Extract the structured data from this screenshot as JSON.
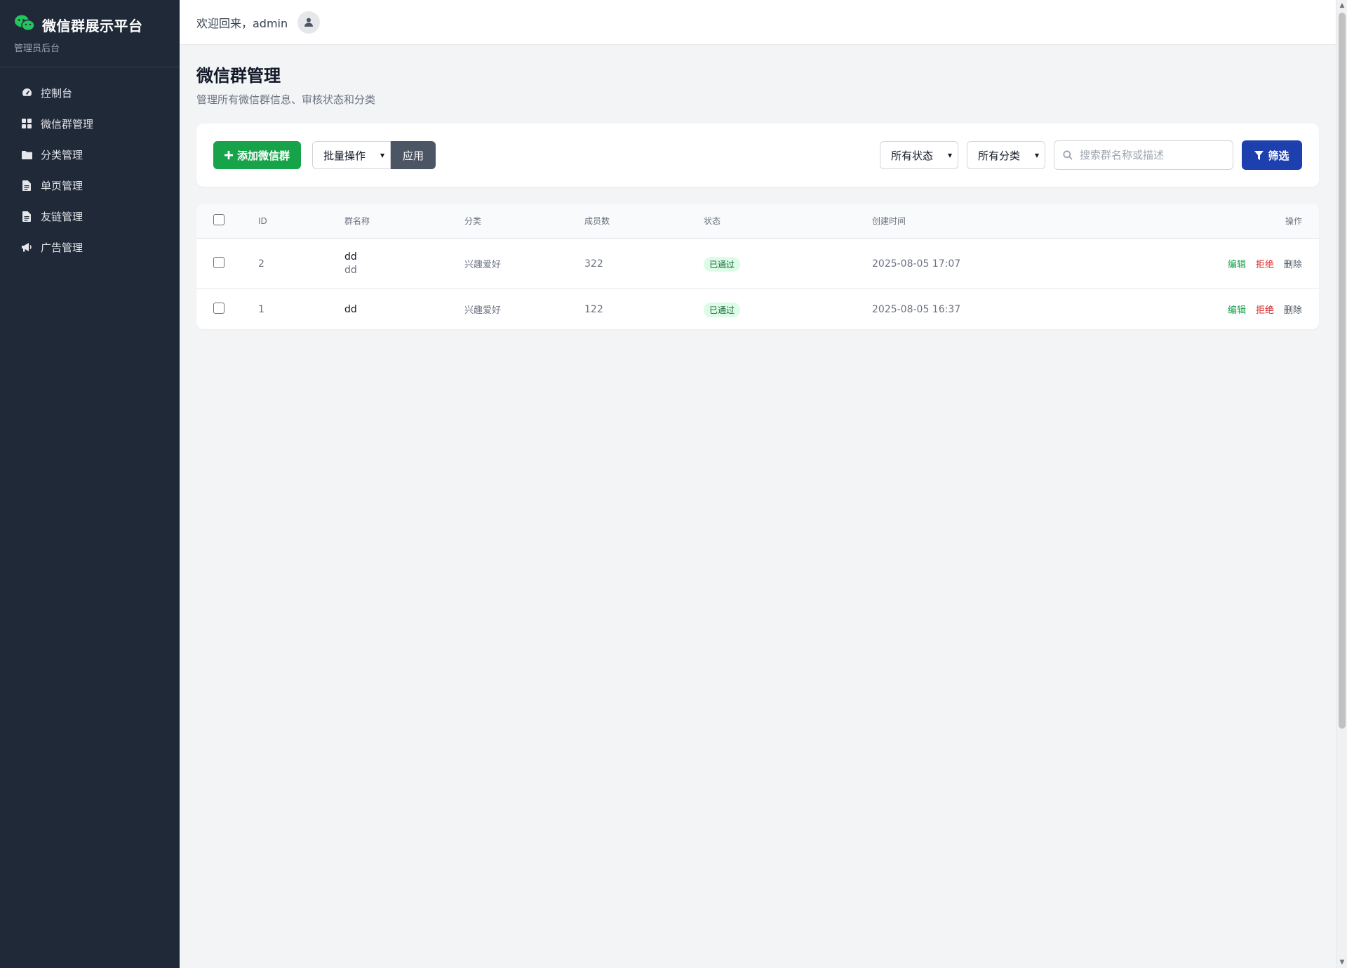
{
  "colors": {
    "sidebar_bg": "#1f2937",
    "primary_green": "#16a34a",
    "filter_blue": "#1e40af",
    "apply_gray": "#4b5563",
    "reject_red": "#dc2626",
    "badge_bg": "#dcfce7",
    "page_bg": "#f3f4f6"
  },
  "brand": {
    "title": "微信群展示平台",
    "subtitle": "管理员后台",
    "icon": "wechat-icon"
  },
  "sidebar": {
    "items": [
      {
        "label": "控制台",
        "icon": "dashboard-icon"
      },
      {
        "label": "微信群管理",
        "icon": "grid-icon"
      },
      {
        "label": "分类管理",
        "icon": "folder-icon"
      },
      {
        "label": "单页管理",
        "icon": "file-icon"
      },
      {
        "label": "友链管理",
        "icon": "file-text-icon"
      },
      {
        "label": "广告管理",
        "icon": "megaphone-icon"
      }
    ]
  },
  "header": {
    "welcome": "欢迎回来，admin",
    "avatar_icon": "user-icon"
  },
  "page": {
    "title": "微信群管理",
    "subtitle": "管理所有微信群信息、审核状态和分类"
  },
  "toolbar": {
    "add_label": "添加微信群",
    "batch_selected": "批量操作",
    "apply_label": "应用",
    "status_selected": "所有状态",
    "category_selected": "所有分类",
    "search_placeholder": "搜索群名称或描述",
    "filter_label": "筛选"
  },
  "table": {
    "headers": {
      "id": "ID",
      "name": "群名称",
      "category": "分类",
      "members": "成员数",
      "status": "状态",
      "created": "创建时间",
      "actions": "操作"
    },
    "rows": [
      {
        "id": "2",
        "name": "dd",
        "desc": "dd",
        "category": "兴趣爱好",
        "members": "322",
        "status": "已通过",
        "created": "2025-08-05 17:07"
      },
      {
        "id": "1",
        "name": "dd",
        "desc": "",
        "category": "兴趣爱好",
        "members": "122",
        "status": "已通过",
        "created": "2025-08-05 16:37"
      }
    ],
    "action_labels": {
      "edit": "编辑",
      "reject": "拒绝",
      "delete": "删除"
    }
  }
}
